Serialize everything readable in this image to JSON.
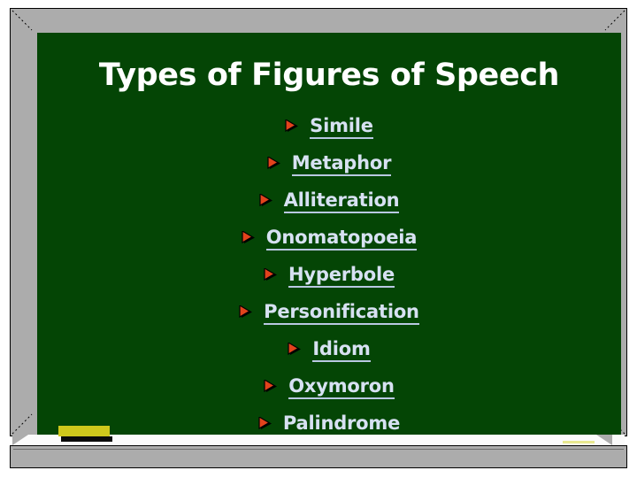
{
  "slide": {
    "title": "Types of Figures of Speech",
    "items": [
      {
        "label": "Simile",
        "bullet": "triangle-right-icon"
      },
      {
        "label": "Metaphor",
        "bullet": "triangle-right-icon"
      },
      {
        "label": "Alliteration",
        "bullet": "triangle-right-icon"
      },
      {
        "label": "Onomatopoeia",
        "bullet": "triangle-right-icon"
      },
      {
        "label": "Hyperbole",
        "bullet": "triangle-right-icon"
      },
      {
        "label": "Personification",
        "bullet": "triangle-right-icon"
      },
      {
        "label": "Idiom",
        "bullet": "triangle-right-icon"
      },
      {
        "label": "Oxymoron",
        "bullet": "triangle-right-icon"
      },
      {
        "label": "Palindrome",
        "bullet": "triangle-right-icon"
      }
    ]
  },
  "objects": {
    "eraser": "chalkboard-eraser",
    "chalk": "chalk-stick"
  },
  "colors": {
    "board_green": "#044505",
    "frame_gray": "#acacac",
    "title_white": "#ffffff",
    "item_text": "#d7e1f2",
    "item_underline": "#b9c8e2",
    "bullet_fill": "#e2431c",
    "bullet_outline": "#000000",
    "eraser_felt": "#cfc81c",
    "eraser_base": "#0b0b0b",
    "chalk": "#e8e890",
    "ledge_white": "#fbfbfb",
    "page_background": "#ffffff"
  }
}
